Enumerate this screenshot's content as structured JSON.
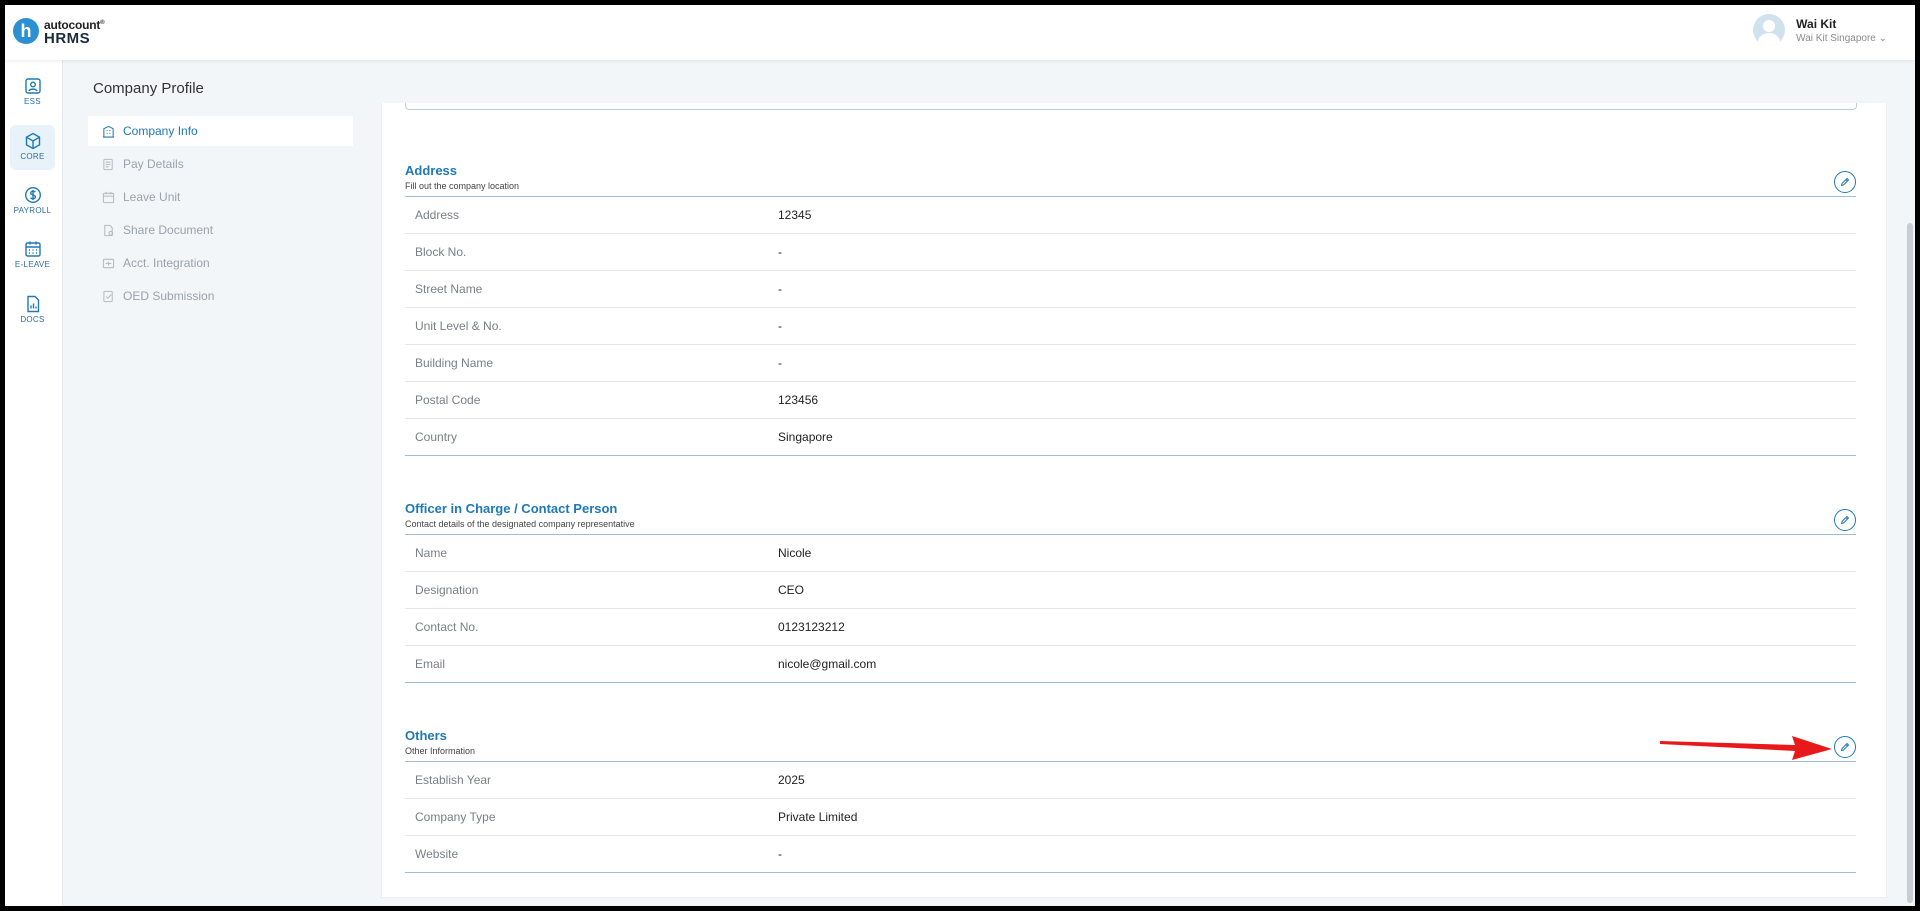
{
  "app": {
    "brand": "autocount",
    "brand_mark": "®",
    "product": "HRMS",
    "logo_letter": "h"
  },
  "user": {
    "name": "Wai Kit",
    "company": "Wai Kit Singapore ⌄"
  },
  "rail": [
    {
      "label": "ESS",
      "icon": "id-card-icon"
    },
    {
      "label": "CORE",
      "icon": "cube-icon",
      "active": true
    },
    {
      "label": "PAYROLL",
      "icon": "dollar-icon"
    },
    {
      "label": "E-LEAVE",
      "icon": "calendar-icon"
    },
    {
      "label": "DOCS",
      "icon": "document-chart-icon"
    }
  ],
  "page": {
    "title": "Company Profile"
  },
  "side_menu": [
    {
      "label": "Company Info",
      "active": true,
      "icon": "building-icon"
    },
    {
      "label": "Pay Details",
      "icon": "pay-icon"
    },
    {
      "label": "Leave Unit",
      "icon": "calendar-unit-icon"
    },
    {
      "label": "Share Document",
      "icon": "share-doc-icon"
    },
    {
      "label": "Acct. Integration",
      "icon": "integration-icon"
    },
    {
      "label": "OED Submission",
      "icon": "submission-icon"
    }
  ],
  "sections": {
    "address": {
      "title": "Address",
      "subtitle": "Fill out the company location",
      "rows": [
        {
          "label": "Address",
          "value": "12345"
        },
        {
          "label": "Block No.",
          "value": "-"
        },
        {
          "label": "Street Name",
          "value": "-"
        },
        {
          "label": "Unit Level & No.",
          "value": "-"
        },
        {
          "label": "Building Name",
          "value": "-"
        },
        {
          "label": "Postal Code",
          "value": "123456"
        },
        {
          "label": "Country",
          "value": "Singapore"
        }
      ]
    },
    "officer": {
      "title": "Officer in Charge / Contact Person",
      "subtitle": "Contact details of the designated company representative",
      "rows": [
        {
          "label": "Name",
          "value": "Nicole"
        },
        {
          "label": "Designation",
          "value": "CEO"
        },
        {
          "label": "Contact No.",
          "value": "0123123212"
        },
        {
          "label": "Email",
          "value": "nicole@gmail.com"
        }
      ]
    },
    "others": {
      "title": "Others",
      "subtitle": "Other Information",
      "rows": [
        {
          "label": "Establish Year",
          "value": "2025"
        },
        {
          "label": "Company Type",
          "value": "Private Limited"
        },
        {
          "label": "Website",
          "value": "-"
        }
      ]
    }
  },
  "colors": {
    "accent": "#1f79b4",
    "annotation_arrow": "#e8191b"
  }
}
